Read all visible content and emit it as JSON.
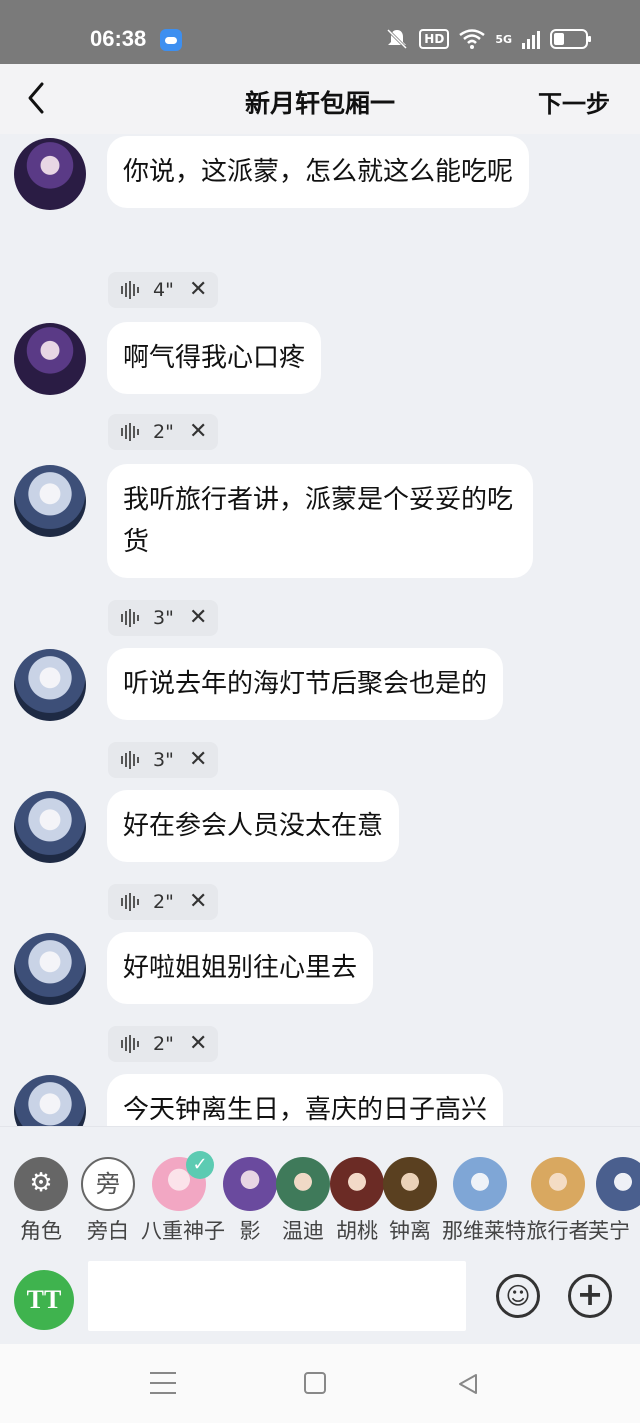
{
  "status_bar": {
    "time": "06:38",
    "hd_label": "HD",
    "network_label": "5G"
  },
  "header": {
    "title": "新月轩包厢一",
    "next_label": "下一步"
  },
  "messages": [
    {
      "avatar": "raiden",
      "text": "你说，这派蒙，怎么就这么能吃呢",
      "voice_duration": "4\""
    },
    {
      "avatar": "raiden",
      "text": "啊气得我心口疼",
      "voice_duration": "2\""
    },
    {
      "avatar": "furina",
      "text": "我听旅行者讲，派蒙是个妥妥的吃货",
      "voice_duration": "3\""
    },
    {
      "avatar": "furina",
      "text": "听说去年的海灯节后聚会也是的",
      "voice_duration": "3\""
    },
    {
      "avatar": "furina",
      "text": "好在参会人员没太在意",
      "voice_duration": "2\""
    },
    {
      "avatar": "furina",
      "text": "好啦姐姐别往心里去",
      "voice_duration": "2\""
    },
    {
      "avatar": "furina",
      "text": "今天钟离生日，喜庆的日子高兴"
    }
  ],
  "roles": [
    {
      "name": "角色",
      "icon": "role-settings-icon"
    },
    {
      "name": "旁白",
      "badge": "旁"
    },
    {
      "name": "八重神子",
      "selected": true,
      "color": "#f2a7c3"
    },
    {
      "name": "影",
      "color": "#6a4a9e"
    },
    {
      "name": "温迪",
      "color": "#3f7a5a"
    },
    {
      "name": "胡桃",
      "color": "#6b2b25"
    },
    {
      "name": "钟离",
      "color": "#5a4020"
    },
    {
      "name": "那维莱特",
      "color": "#7fa6d6"
    },
    {
      "name": "旅行者",
      "color": "#d9a860"
    },
    {
      "name": "芙宁",
      "color": "#4a5f8e"
    }
  ],
  "input": {
    "placeholder": "",
    "format_label": "TT"
  },
  "colors": {
    "accent_green": "#3fb34e",
    "check_teal": "#5ccbb2",
    "status_bar": "#7a7a7a"
  }
}
